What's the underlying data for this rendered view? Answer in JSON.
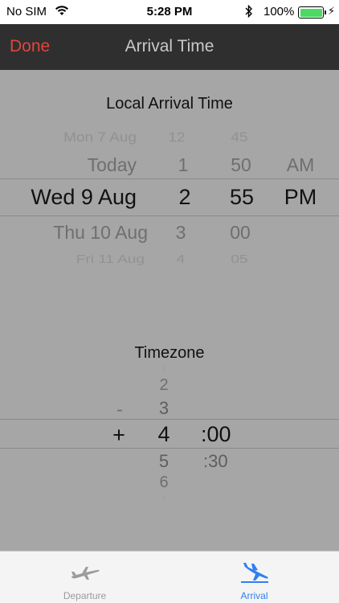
{
  "status": {
    "carrier": "No SIM",
    "time": "5:28 PM",
    "battery": "100%"
  },
  "nav": {
    "done_label": "Done",
    "title": "Arrival Time"
  },
  "arrival_picker": {
    "title": "Local Arrival Time",
    "dates": [
      "Mon 7 Aug",
      "Today",
      "Wed 9 Aug",
      "Thu 10 Aug",
      "Fri 11 Aug"
    ],
    "hours": [
      "12",
      "1",
      "2",
      "3",
      "4"
    ],
    "minutes": [
      "45",
      "50",
      "55",
      "00",
      "05"
    ],
    "ampm": [
      "AM",
      "PM"
    ]
  },
  "timezone_picker": {
    "title": "Timezone",
    "signs": [
      "-",
      "+"
    ],
    "hours": [
      "1",
      "2",
      "3",
      "4",
      "5",
      "6",
      "7"
    ],
    "minutes": [
      ":00",
      ":30"
    ]
  },
  "tabs": [
    {
      "label": "Departure",
      "active": false
    },
    {
      "label": "Arrival",
      "active": true
    }
  ],
  "colors": {
    "accent": "#e0463c",
    "tab_active": "#2f7ff2",
    "tab_inactive": "#9b9b9b"
  }
}
